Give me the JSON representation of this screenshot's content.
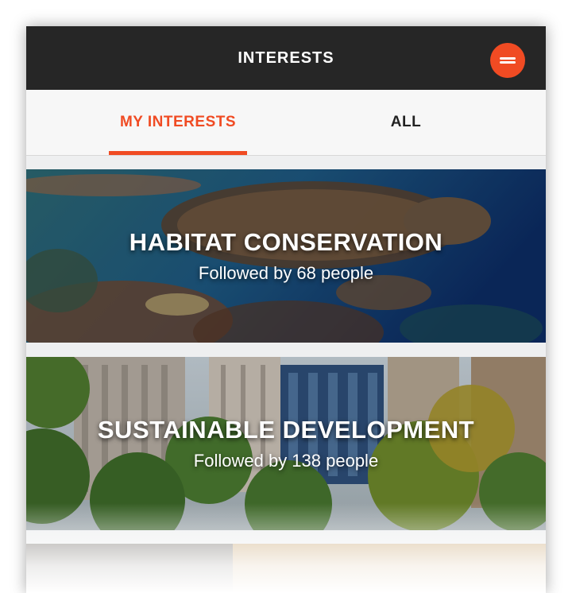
{
  "header": {
    "title": "INTERESTS",
    "menu_icon": "menu-icon",
    "accent": "#f04b23",
    "bg": "#262626"
  },
  "tabs": [
    {
      "label": "MY INTERESTS",
      "active": true
    },
    {
      "label": "ALL",
      "active": false
    }
  ],
  "cards": [
    {
      "title": "HABITAT CONSERVATION",
      "subtitle": "Followed by 68 people"
    },
    {
      "title": "SUSTAINABLE DEVELOPMENT",
      "subtitle": "Followed by 138 people"
    }
  ]
}
